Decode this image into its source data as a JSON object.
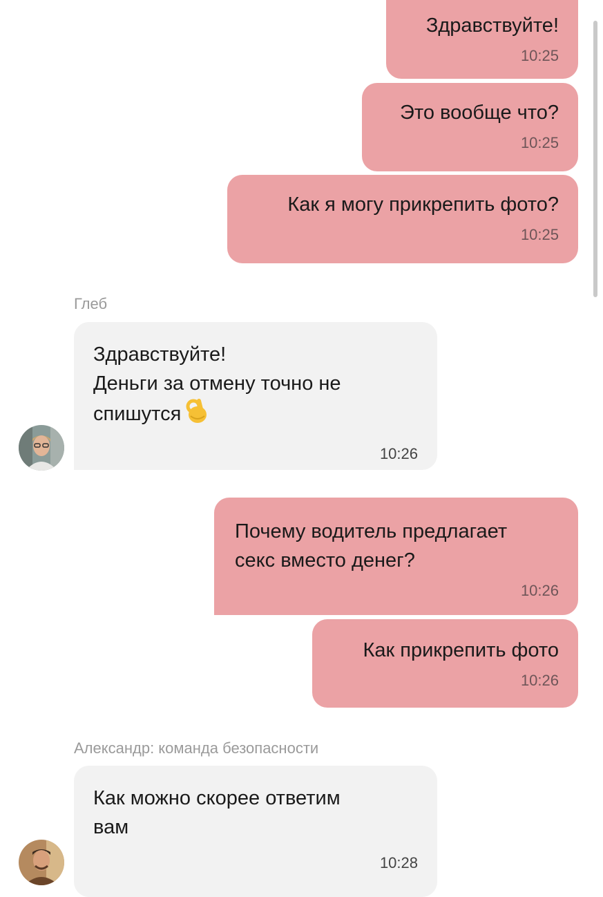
{
  "messages": {
    "m1": {
      "text": "Здравствуйте!",
      "time": "10:25"
    },
    "m2": {
      "text": "Это вообще что?",
      "time": "10:25"
    },
    "m3": {
      "text": "Как я могу прикрепить фото?",
      "time": "10:25"
    },
    "sender1": "Глеб",
    "m4": {
      "text": "Здравствуйте!\nДеньги за отмену точно не\nспишутся",
      "time": "10:26"
    },
    "m5": {
      "text": "Почему водитель предлагает\nсекс вместо денег?",
      "time": "10:26"
    },
    "m6": {
      "text": "Как прикрепить фото",
      "time": "10:26"
    },
    "sender2": "Александр: команда безопасности",
    "m7": {
      "text": "Как можно скорее ответим\nвам",
      "time": "10:28"
    }
  },
  "icons": {
    "ok_emoji": "ok-hand-emoji",
    "avatar1": "avatar-gleb",
    "avatar2": "avatar-alexander"
  },
  "colors": {
    "outgoing_bubble": "#eba2a5",
    "incoming_bubble": "#f2f2f2",
    "sender_name": "#9a9a9a"
  }
}
